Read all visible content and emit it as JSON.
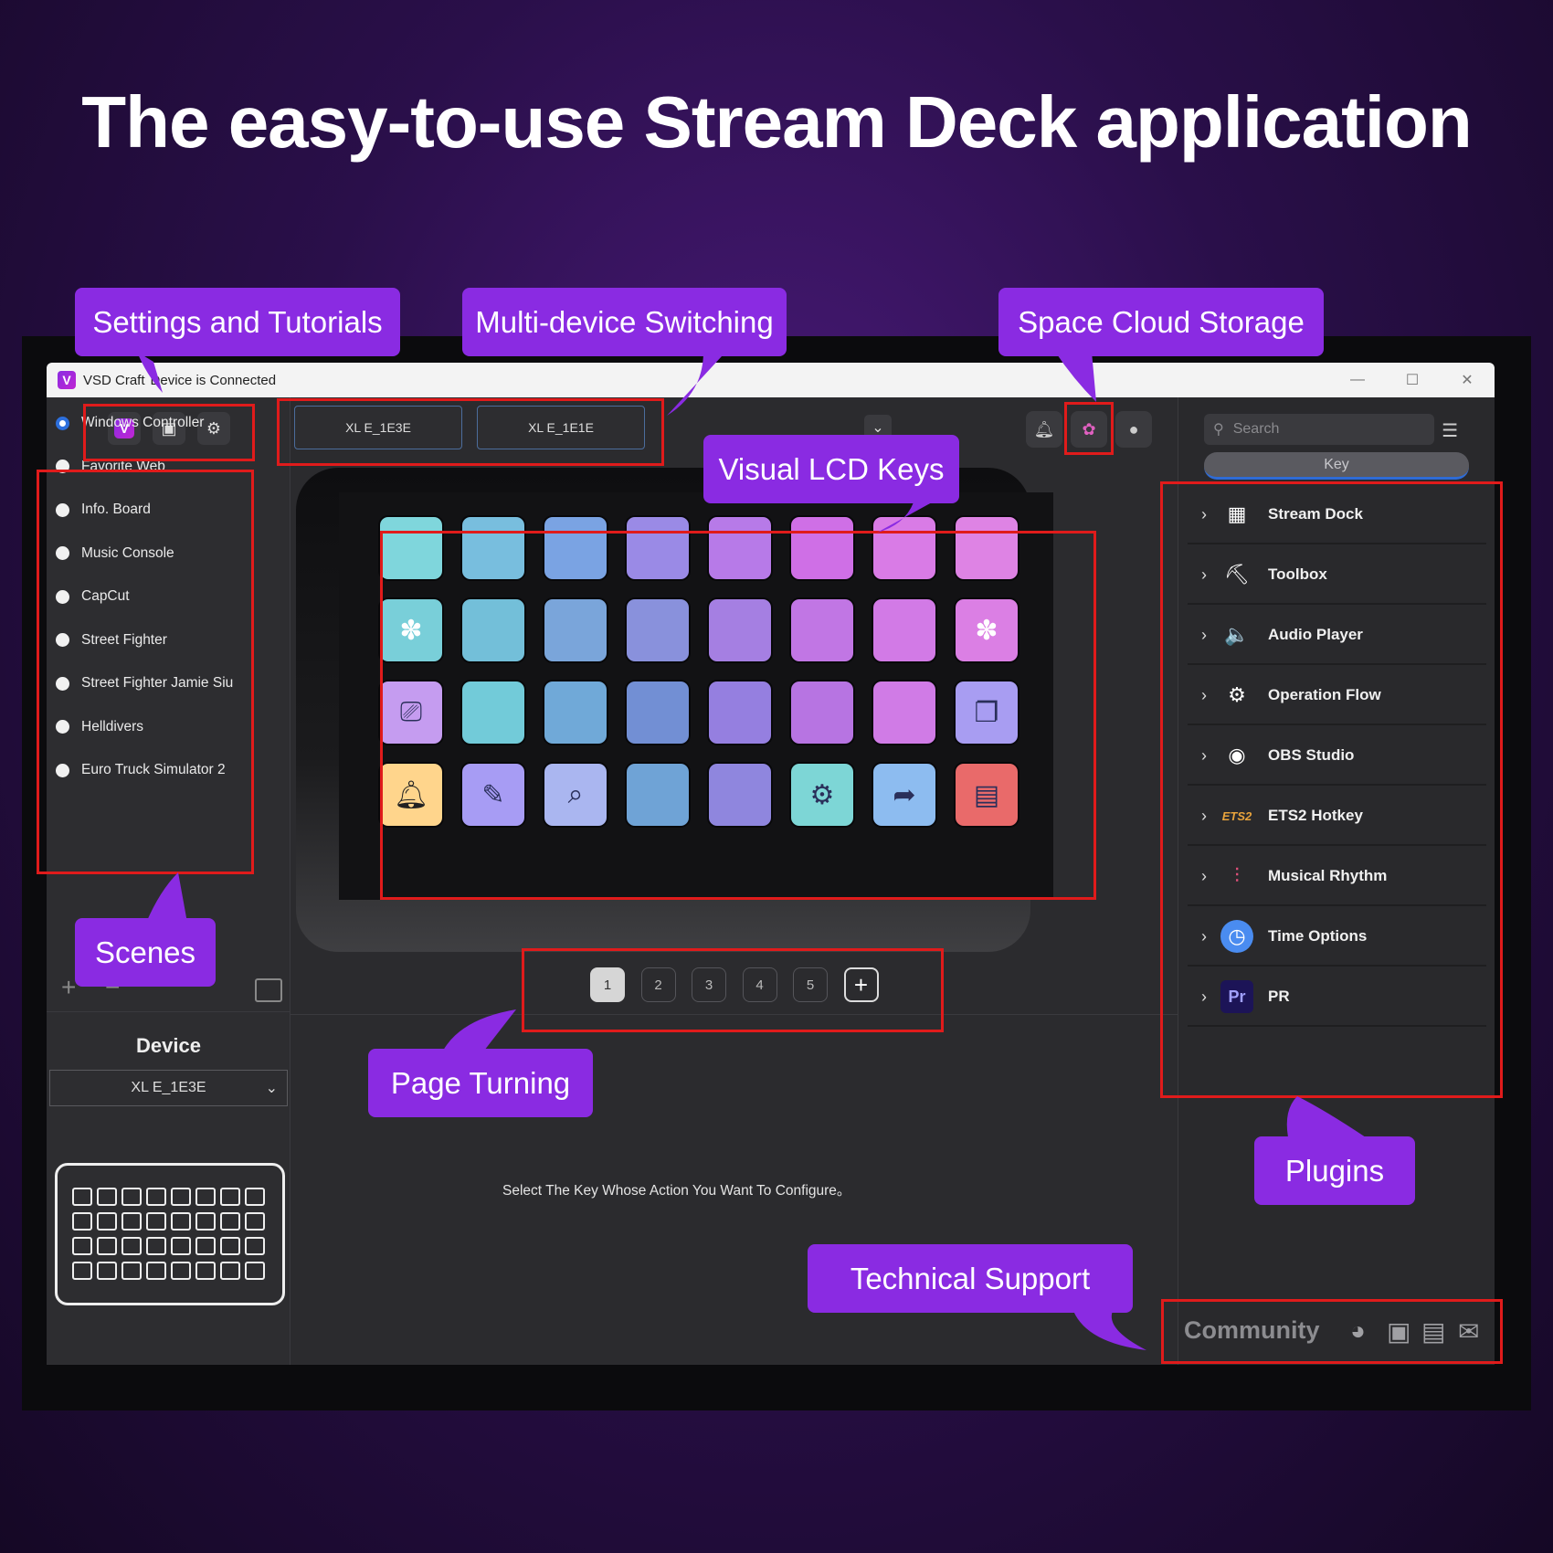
{
  "headline": "The easy-to-use Stream Deck application",
  "window": {
    "app_name": "VSD Craft",
    "status": "Device is Connected",
    "logo_letter": "V"
  },
  "device_tabs": [
    "XL E_1E3E",
    "XL E_1E1E"
  ],
  "scenes": [
    {
      "label": "Windows Controller",
      "selected": true
    },
    {
      "label": "Favorite Web",
      "selected": false
    },
    {
      "label": "Info. Board",
      "selected": false
    },
    {
      "label": "Music Console",
      "selected": false
    },
    {
      "label": "CapCut",
      "selected": false
    },
    {
      "label": "Street Fighter",
      "selected": false
    },
    {
      "label": "Street Fighter Jamie Siu",
      "selected": false
    },
    {
      "label": "Helldivers",
      "selected": false
    },
    {
      "label": "Euro Truck Simulator 2",
      "selected": false
    }
  ],
  "device_panel": {
    "title": "Device",
    "selected_device": "XL E_1E3E"
  },
  "pages": [
    "1",
    "2",
    "3",
    "4",
    "5"
  ],
  "active_page": "1",
  "config_hint": "Select The Key Whose Action You Want To Configure。",
  "search": {
    "placeholder": "Search"
  },
  "key_tab": "Key",
  "plugins": [
    {
      "label": "Stream Dock",
      "icon": "grid-keypad-icon",
      "glyph": "▦",
      "color": "#ffffff"
    },
    {
      "label": "Toolbox",
      "icon": "toolbox-icon",
      "glyph": "⛏",
      "color": "#ffffff"
    },
    {
      "label": "Audio Player",
      "icon": "speaker-icon",
      "glyph": "🔈",
      "color": "#ffffff"
    },
    {
      "label": "Operation Flow",
      "icon": "flow-icon",
      "glyph": "⚙",
      "color": "#ffffff"
    },
    {
      "label": "OBS Studio",
      "icon": "obs-icon",
      "glyph": "◉",
      "color": "#ffffff"
    },
    {
      "label": "ETS2 Hotkey",
      "icon": "ets2-icon",
      "glyph": "ETS2",
      "color": "#e8a33c"
    },
    {
      "label": "Musical Rhythm",
      "icon": "rhythm-icon",
      "glyph": "⫶",
      "color": "#e0507a"
    },
    {
      "label": "Time Options",
      "icon": "clock-icon",
      "glyph": "◷",
      "color": "#4a8cf0"
    },
    {
      "label": "PR",
      "icon": "premiere-pro-icon",
      "glyph": "Pr",
      "color": "#1c1457"
    }
  ],
  "community": {
    "label": "Community"
  },
  "key_colors": [
    [
      "#7fd6dc",
      "#78bede",
      "#7aa3e3",
      "#9a8ae6",
      "#b77ae8",
      "#cf6fe6",
      "#d97be6",
      "#de83e4"
    ],
    [
      "#79cfd9",
      "#73bfd9",
      "#7aa5da",
      "#8991dc",
      "#a57fe2",
      "#c176e4",
      "#d27ae6",
      "#db7fe4"
    ],
    [
      "#c59cf0",
      "#72cbd9",
      "#70a9d8",
      "#728fd4",
      "#957fe0",
      "#b774e2",
      "#d07be6",
      "#a89df2"
    ],
    [
      "#ffd58c",
      "#a79cf4",
      "#aab6f0",
      "#6fa3d6",
      "#8f86de",
      "#7dd6d6",
      "#8dbcf0",
      "#e96a6a"
    ]
  ],
  "key_icons": [
    [
      "",
      "",
      "",
      "",
      "",
      "",
      "",
      ""
    ],
    [
      "paw-icon",
      "",
      "",
      "",
      "",
      "",
      "",
      "paw-icon"
    ],
    [
      "monitor-back-icon",
      "",
      "",
      "",
      "",
      "",
      "",
      "window-copy-icon"
    ],
    [
      "bell-icon",
      "edit-doc-icon",
      "doc-search-icon",
      "",
      "",
      "settings-icon",
      "folder-share-icon",
      "dashboard-icon"
    ]
  ],
  "callouts": {
    "settings": "Settings and Tutorials",
    "multidevice": "Multi-device Switching",
    "cloud": "Space Cloud Storage",
    "lcd": "Visual LCD Keys",
    "scenes": "Scenes",
    "paging": "Page Turning",
    "plugins": "Plugins",
    "support": "Technical Support"
  },
  "accent_color": "#8a2be2",
  "highlight_color": "#e01b1b"
}
